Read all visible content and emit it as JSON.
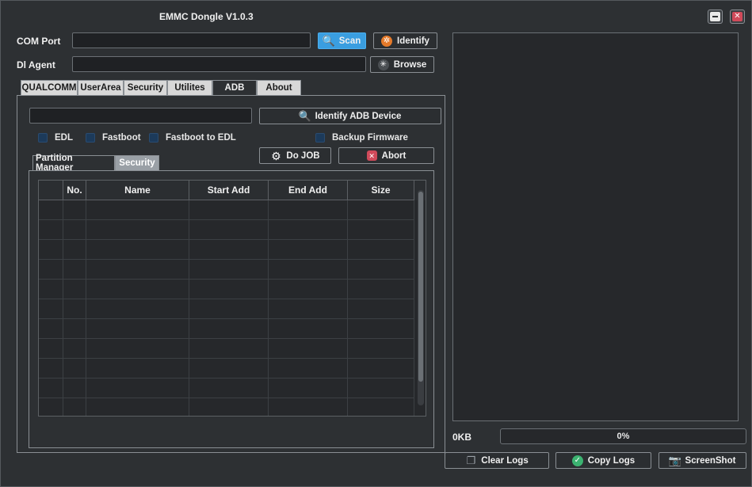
{
  "window": {
    "title": "EMMC Dongle V1.0.3",
    "minimize_glyph": "–",
    "close_glyph": "✕"
  },
  "top": {
    "com_port_label": "COM Port",
    "com_port_value": "",
    "scan_label": "Scan",
    "identify_label": "Identify",
    "dl_agent_label": "Dl  Agent",
    "dl_agent_value": "",
    "browse_label": "Browse"
  },
  "tabs": [
    {
      "label": "QUALCOMM",
      "active": false
    },
    {
      "label": "UserArea",
      "active": false
    },
    {
      "label": "Security",
      "active": false
    },
    {
      "label": "Utilites",
      "active": false
    },
    {
      "label": "ADB",
      "active": true
    },
    {
      "label": "About",
      "active": false
    }
  ],
  "adb": {
    "device_field_value": "",
    "identify_adb_label": "Identify ADB Device",
    "options": {
      "edl": "EDL",
      "fastboot": "Fastboot",
      "fastboot_to_edl": "Fastboot to EDL",
      "backup_firmware": "Backup Firmware"
    },
    "do_job_label": "Do JOB",
    "abort_label": "Abort",
    "subtabs": [
      {
        "label": "Partition Manager",
        "active": false
      },
      {
        "label": "Security",
        "active": true
      }
    ],
    "table": {
      "columns": [
        "",
        "No.",
        "Name",
        "Start Add",
        "End Add",
        "Size"
      ],
      "rows": []
    }
  },
  "log": {
    "size_label": "0KB",
    "progress": "0%",
    "clear_label": "Clear Logs",
    "copy_label": "Copy Logs",
    "screenshot_label": "ScreenShot"
  },
  "colors": {
    "accent": "#3a9ee0",
    "close": "#d04a5a",
    "identify": "#e57a2a",
    "copy": "#3cb371"
  }
}
